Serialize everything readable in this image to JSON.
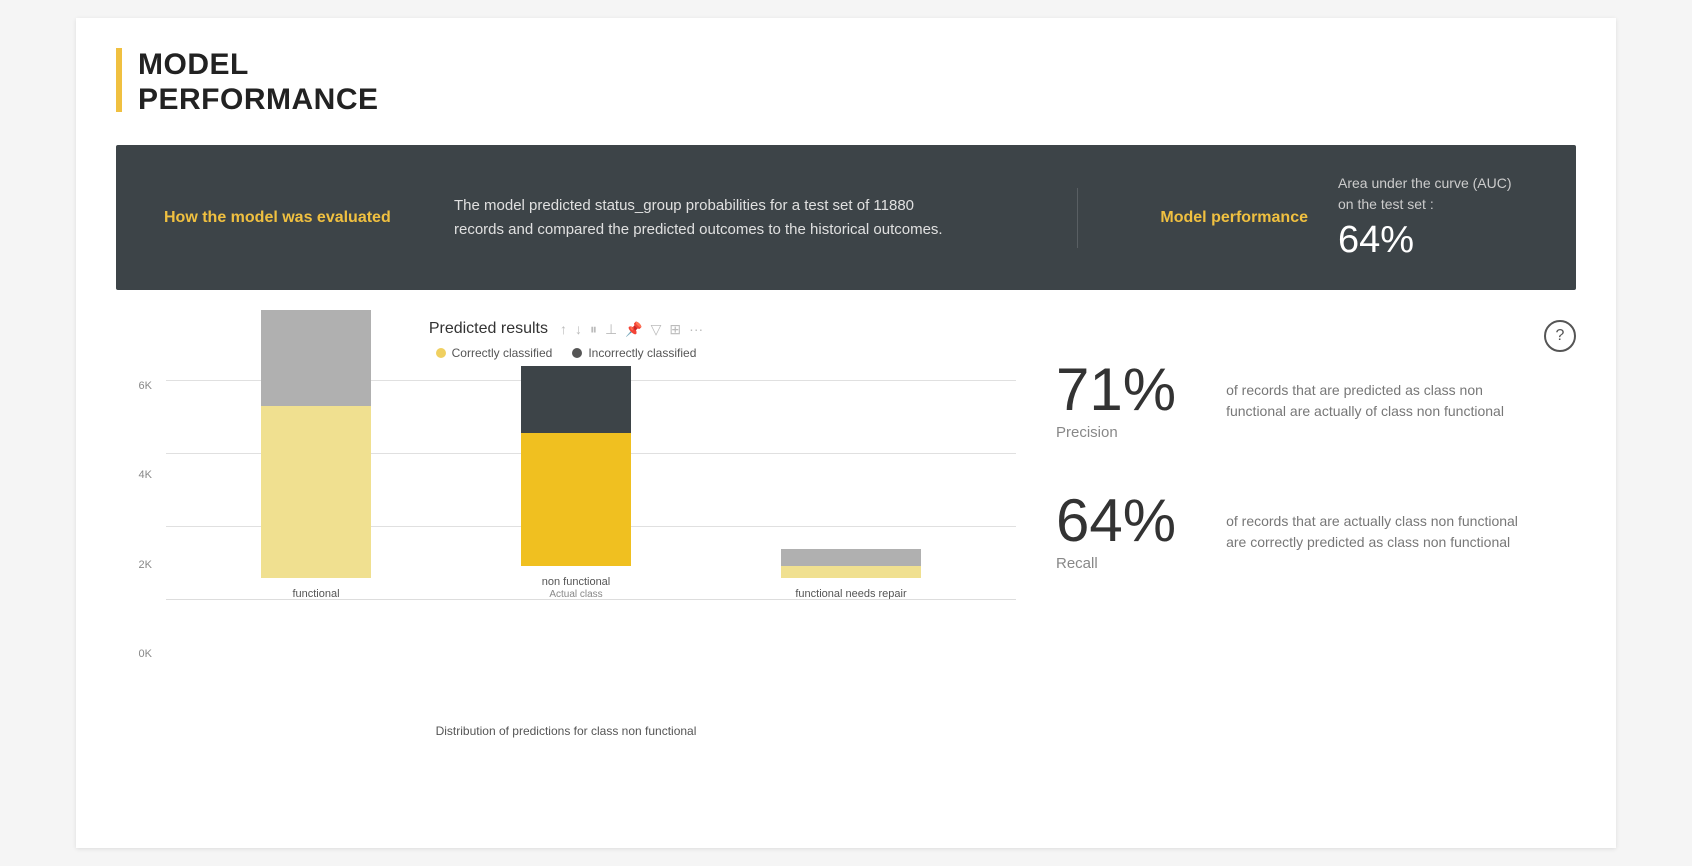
{
  "header": {
    "title_line1": "MODEL",
    "title_line2": "PERFORMANCE"
  },
  "banner": {
    "left_label": "How the model was evaluated",
    "description": "The model predicted status_group probabilities for a test set of 11880 records and compared the predicted outcomes to the historical outcomes.",
    "metric_label": "Model performance",
    "auc_description": "Area under the curve (AUC) on the test set :",
    "auc_value": "64%"
  },
  "chart": {
    "title": "Predicted results",
    "legend": [
      {
        "label": "Correctly classified",
        "color": "#f0d060"
      },
      {
        "label": "Incorrectly classified",
        "color": "#555555"
      }
    ],
    "toolbar_icons": [
      "↑",
      "↓",
      "||",
      "⊥",
      "✕",
      "▽",
      "⊞",
      "···"
    ],
    "y_labels": [
      "6K",
      "4K",
      "2K",
      "0K"
    ],
    "bars": [
      {
        "category": "functional",
        "correctly": 4100,
        "incorrectly": 2300,
        "max": 6400,
        "correct_color": "#f0e090",
        "incorrect_color": "#aaaaaa"
      },
      {
        "category": "non functional",
        "xlabel2": "Actual class",
        "correctly": 3200,
        "incorrectly": 1600,
        "max": 4800,
        "correct_color": "#f0c020",
        "incorrect_color": "#3d4448"
      },
      {
        "category": "functional needs repair",
        "correctly": 300,
        "incorrectly": 400,
        "max": 700,
        "correct_color": "#f0e090",
        "incorrect_color": "#aaaaaa"
      }
    ],
    "caption": "Distribution of predictions for class non functional"
  },
  "metrics": [
    {
      "value": "71%",
      "name": "Precision",
      "description": "of records that are predicted as class non functional are actually of class non functional"
    },
    {
      "value": "64%",
      "name": "Recall",
      "description": "of records that are actually class non functional are correctly predicted as class non functional"
    }
  ]
}
